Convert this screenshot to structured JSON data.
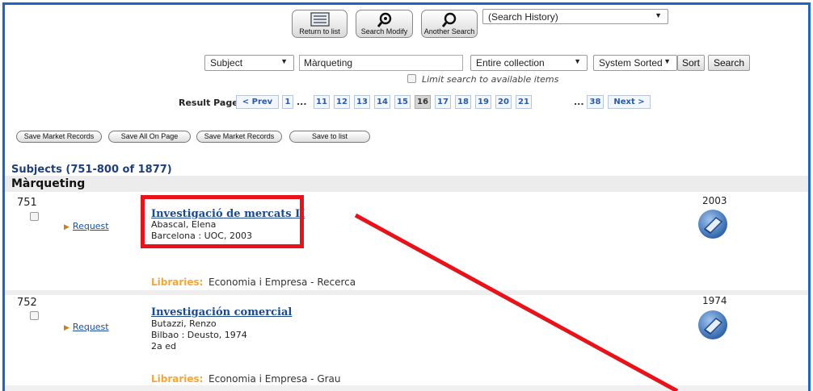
{
  "top_buttons": {
    "return": "Return to list",
    "modify": "Search Modify",
    "another": "Another Search"
  },
  "search_history": {
    "value": "(Search History)"
  },
  "search": {
    "field": "Subject",
    "query": "Màrqueting",
    "scope": "Entire collection",
    "sort": "System Sorted",
    "sort_button": "Sort",
    "search_button": "Search",
    "limit_label": "Limit search to available items"
  },
  "pagination": {
    "label": "Result Page",
    "prev": "< Prev",
    "first": "1",
    "dots": "...",
    "pages": [
      "11",
      "12",
      "13",
      "14",
      "15",
      "16",
      "17",
      "18",
      "19",
      "20",
      "21"
    ],
    "current": "16",
    "last": "38",
    "next": "Next >"
  },
  "save_buttons": [
    "Save Market Records",
    "Save All On Page",
    "Save Market Records",
    "Save to list"
  ],
  "results": {
    "header": "Subjects (751-800 of 1877)",
    "subject": "Màrqueting",
    "records": [
      {
        "number": "751",
        "request": "Request",
        "title": "Investigació de mercats II",
        "author": "Abascal, Elena",
        "imprint": "Barcelona : UOC, 2003",
        "edition": "",
        "year": "2003",
        "libraries_label": "Libraries:",
        "libraries": "Economia i Empresa - Recerca"
      },
      {
        "number": "752",
        "request": "Request",
        "title": "Investigación comercial",
        "author": "Butazzi, Renzo",
        "imprint": "Bilbao : Deusto, 1974",
        "edition": "2a ed",
        "year": "1974",
        "libraries_label": "Libraries:",
        "libraries": "Economia i Empresa - Grau"
      }
    ]
  },
  "colors": {
    "frame": "#1f63c6",
    "annotation": "#e8121a",
    "libraries_label": "#f2a63b",
    "title_link": "#1d4a8c"
  },
  "icons": [
    "list-icon",
    "search-modify-icon",
    "magnifier-icon",
    "book-icon",
    "triangle-icon"
  ]
}
